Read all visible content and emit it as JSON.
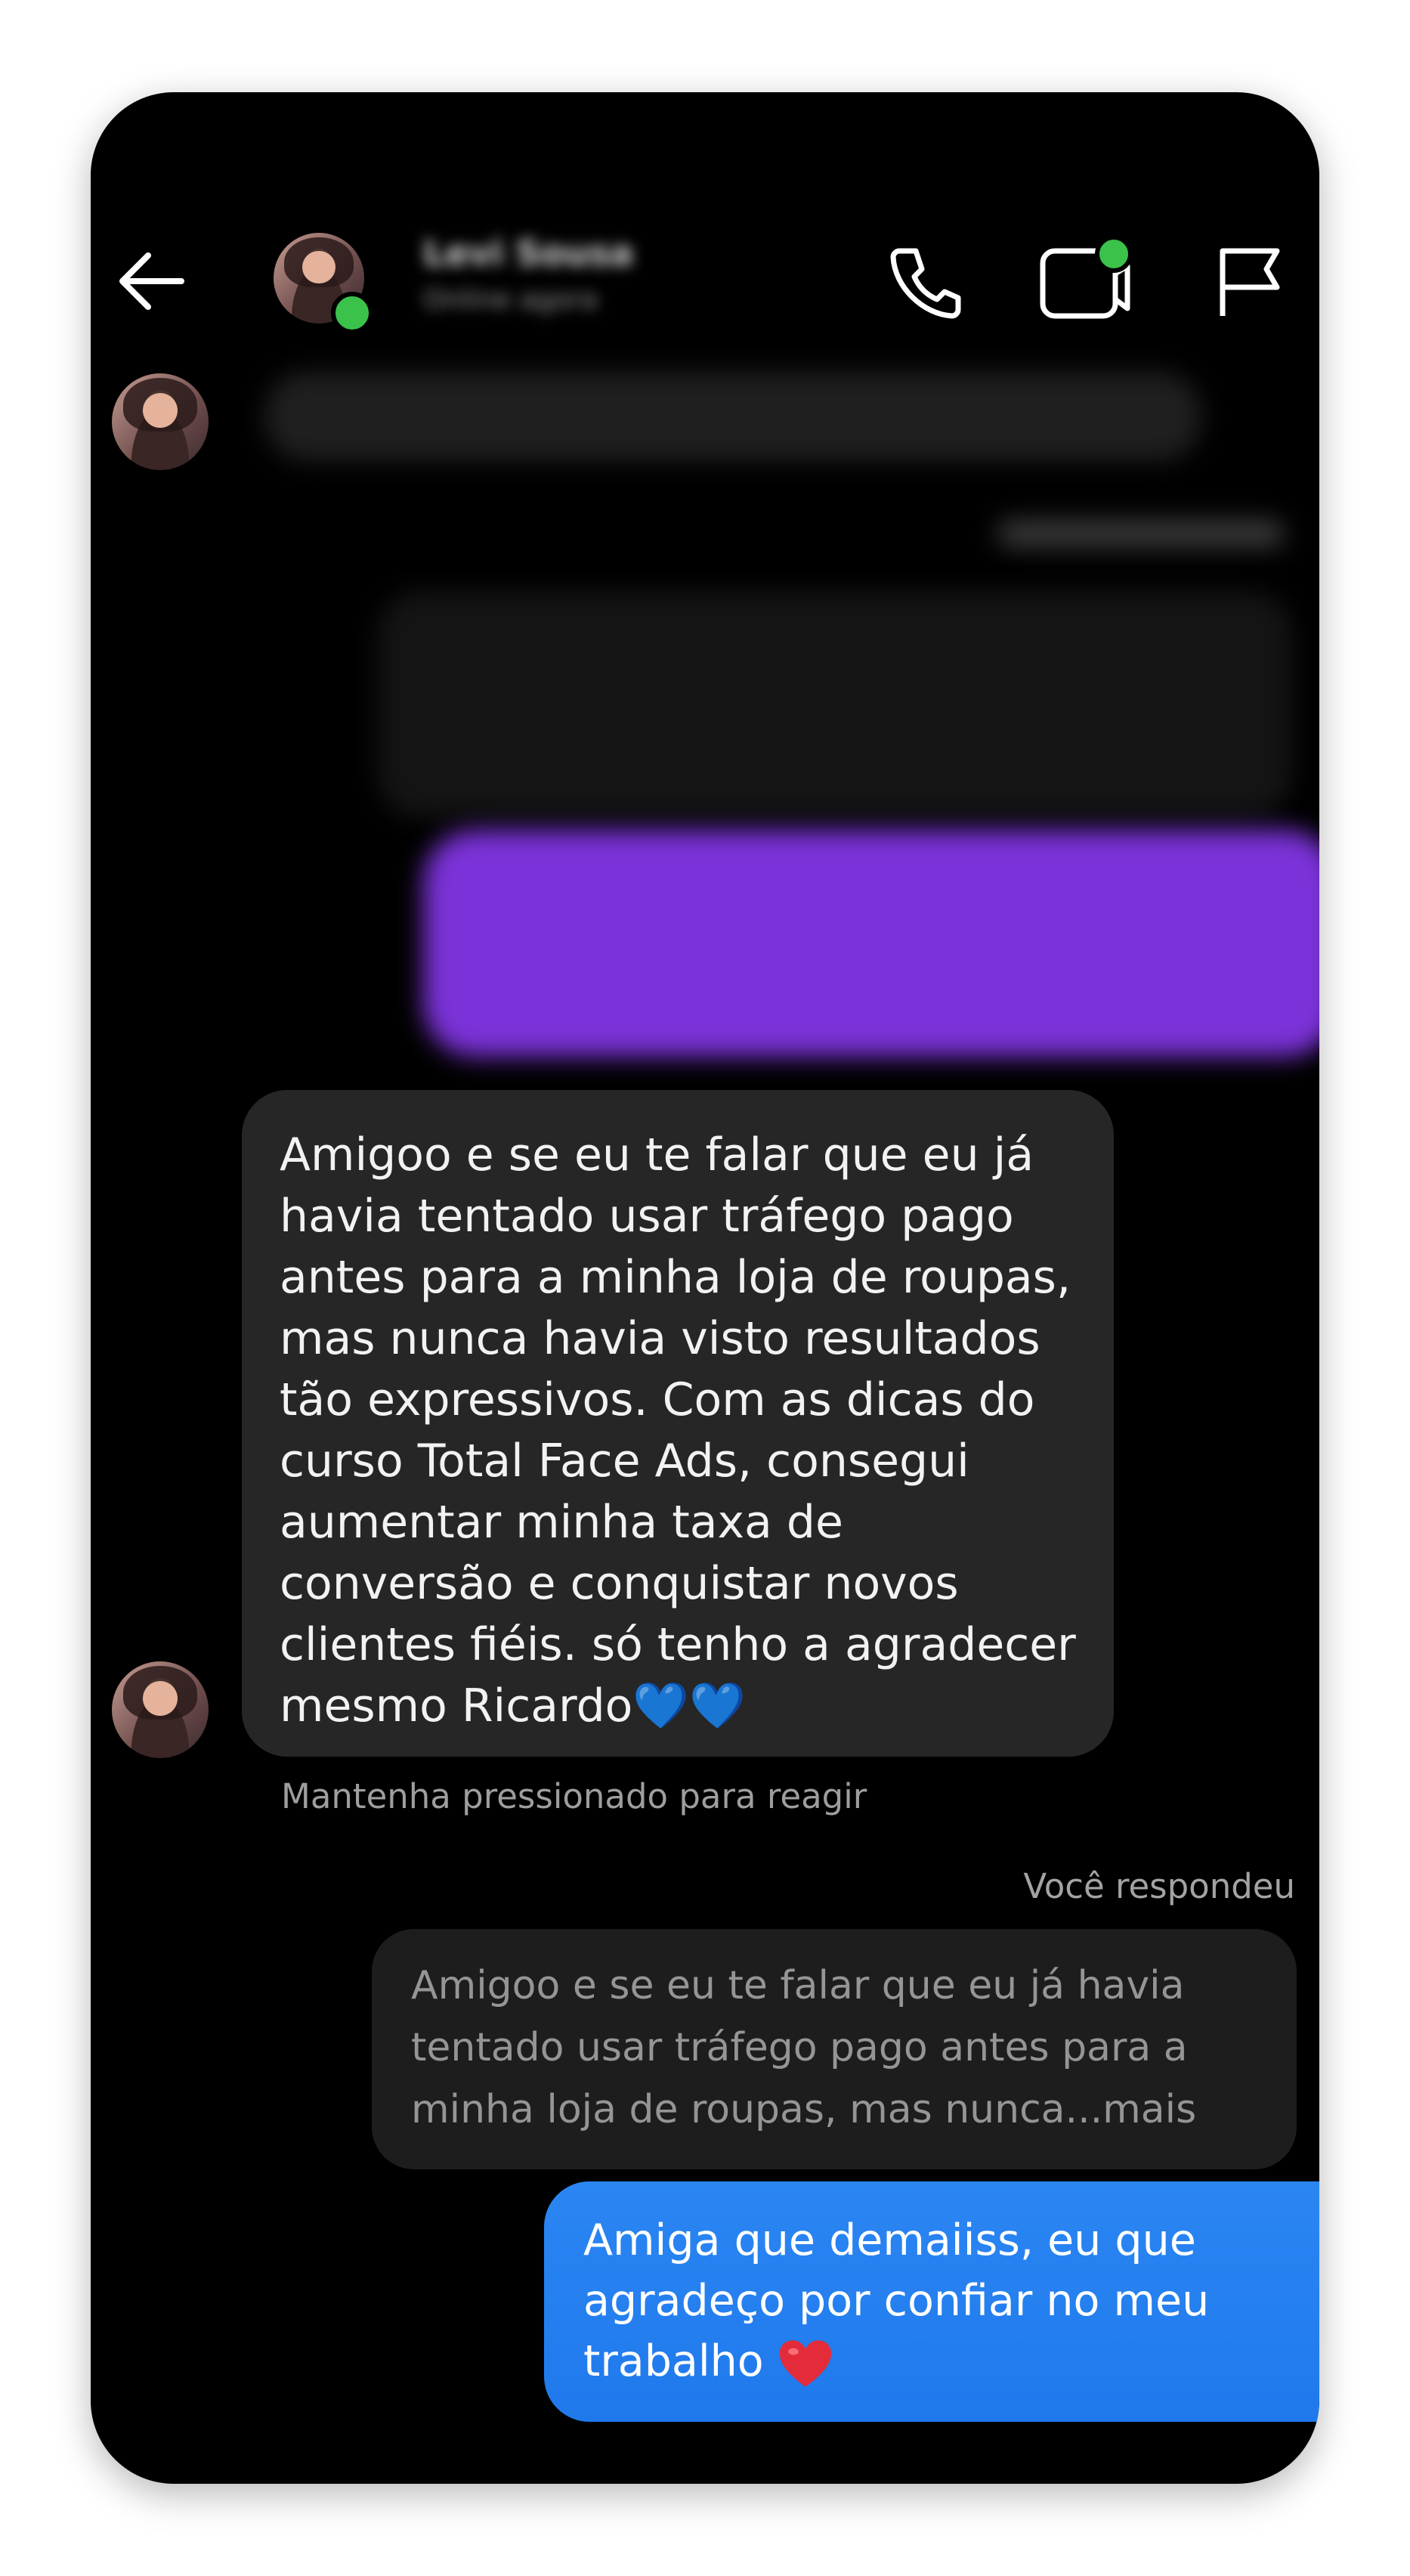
{
  "header": {
    "contact_name": "Levi Sousa",
    "contact_status": "Online agora"
  },
  "messages": {
    "incoming_text": "Amigoo e se eu te falar que eu já havia tentado usar tráfego pago antes para a minha loja de roupas, mas nunca havia visto resultados tão expressivos. Com as dicas do curso Total Face Ads, consegui aumentar minha taxa de conversão e conquistar novos clientes fiéis. só tenho a agradecer mesmo Ricardo",
    "incoming_emoji": "💙💙",
    "react_hint": "Mantenha pressionado para reagir",
    "you_replied_label": "Você respondeu",
    "quoted_text": "Amigoo e se eu te falar que eu já havia tentado usar tráfego pago antes para a minha loja de roupas, mas nunca...mais",
    "outgoing_text": "Amiga que demaiiss, eu que agradeço por confiar no meu trabalho"
  },
  "colors": {
    "background": "#000000",
    "incoming_bubble": "#262626",
    "outgoing_bubble": "#2481f1",
    "blurred_purple_bubble": "#7b32d8",
    "online": "#3bc24a"
  },
  "icons": [
    "back-arrow-icon",
    "phone-icon",
    "video-call-icon",
    "flag-icon",
    "heart-emoji-icon"
  ]
}
